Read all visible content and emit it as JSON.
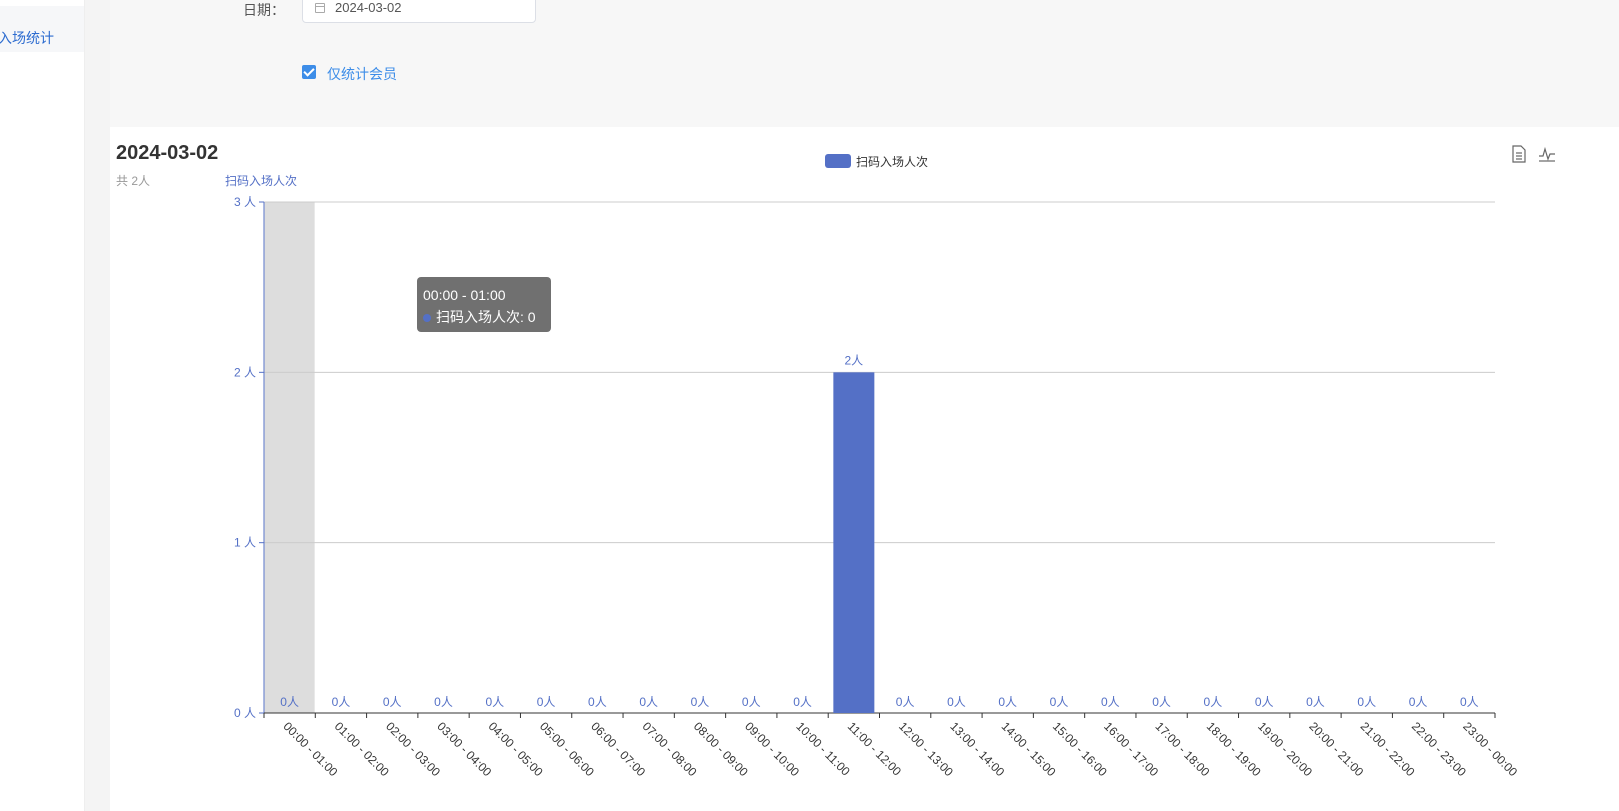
{
  "sidebar": {
    "active_item_label": "入场统计"
  },
  "filter": {
    "date_label": "日期：",
    "date_value": "2024-03-02",
    "member_only_label": "仅统计会员",
    "member_only_checked": true
  },
  "toolbox": {
    "data_view_icon": "data-view-icon",
    "line_switch_icon": "line-chart-icon"
  },
  "tooltip": {
    "title": "00:00 - 01:00",
    "series_name": "扫码入场人次",
    "value": "0",
    "row_text": "扫码入场人次: 0"
  },
  "colors": {
    "series": "#5470c6",
    "highlight": "#dddddd",
    "accent": "#3d8de8"
  },
  "chart_data": {
    "type": "bar",
    "title": "2024-03-02",
    "subtitle": "共 2人",
    "ylabel": "扫码入场人次",
    "ylim": [
      0,
      3
    ],
    "y_ticks": [
      0,
      1,
      2,
      3
    ],
    "y_unit": "人",
    "legend": [
      "扫码入场人次"
    ],
    "legend_position": "top-center",
    "grid": true,
    "highlighted_category": "00:00 - 01:00",
    "categories": [
      "00:00 - 01:00",
      "01:00 - 02:00",
      "02:00 - 03:00",
      "03:00 - 04:00",
      "04:00 - 05:00",
      "05:00 - 06:00",
      "06:00 - 07:00",
      "07:00 - 08:00",
      "08:00 - 09:00",
      "09:00 - 10:00",
      "10:00 - 11:00",
      "11:00 - 12:00",
      "12:00 - 13:00",
      "13:00 - 14:00",
      "14:00 - 15:00",
      "15:00 - 16:00",
      "16:00 - 17:00",
      "17:00 - 18:00",
      "18:00 - 19:00",
      "19:00 - 20:00",
      "20:00 - 21:00",
      "21:00 - 22:00",
      "22:00 - 23:00",
      "23:00 - 00:00"
    ],
    "series": [
      {
        "name": "扫码入场人次",
        "values": [
          0,
          0,
          0,
          0,
          0,
          0,
          0,
          0,
          0,
          0,
          0,
          2,
          0,
          0,
          0,
          0,
          0,
          0,
          0,
          0,
          0,
          0,
          0,
          0
        ]
      }
    ]
  }
}
